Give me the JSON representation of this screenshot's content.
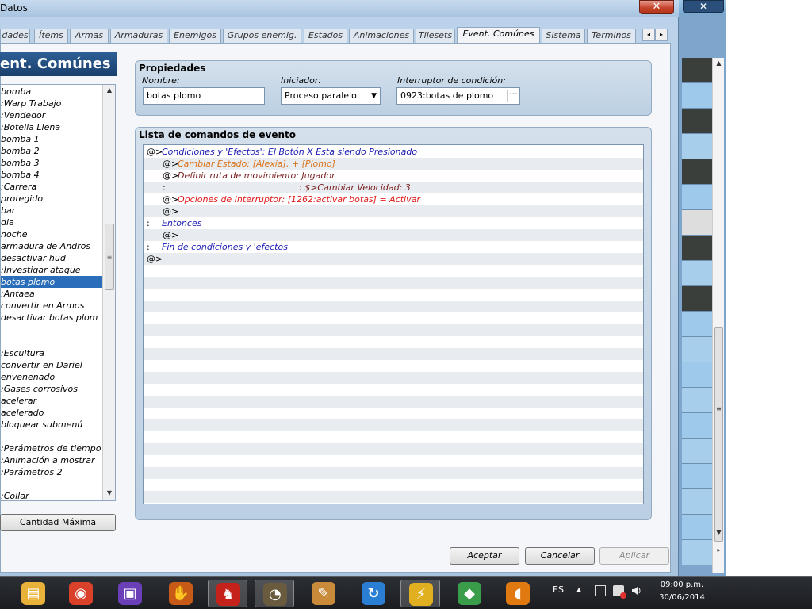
{
  "window": {
    "title": "Datos",
    "close_glyph": "✕"
  },
  "tabs": [
    {
      "label": "dades"
    },
    {
      "label": "Ítems"
    },
    {
      "label": "Armas"
    },
    {
      "label": "Armaduras"
    },
    {
      "label": "Enemigos"
    },
    {
      "label": "Grupos enemig."
    },
    {
      "label": "Estados"
    },
    {
      "label": "Animaciones"
    },
    {
      "label": "Tilesets"
    },
    {
      "label": "Event. Comúnes",
      "active": true
    },
    {
      "label": "Sistema"
    },
    {
      "label": "Terminos"
    }
  ],
  "tab_scroll": {
    "left": "◂",
    "right": "▸"
  },
  "list": {
    "header": "ent. Comúnes",
    "selected_index": 16,
    "items": [
      "bomba",
      ":Warp Trabajo",
      ":Vendedor",
      ":Botella Llena",
      "bomba 1",
      "bomba 2",
      "bomba 3",
      "bomba 4",
      ":Carrera",
      "protegido",
      "bar",
      "dia",
      "noche",
      "armadura de Andros",
      "desactivar hud",
      ":Investigar ataque",
      "botas plomo",
      ":Antaea",
      "convertir en Armos",
      "desactivar botas plom",
      "",
      "",
      ":Escultura",
      "convertir en Dariel",
      "envenenado",
      ":Gases corrosivos",
      "acelerar",
      "acelerado",
      "bloquear submenú",
      "",
      ":Parámetros de tiempo",
      ":Animación a mostrar",
      ":Parámetros 2",
      "",
      ":Collar"
    ],
    "scroll_up": "▲",
    "scroll_down": "▼",
    "thumb_grip": "≡"
  },
  "max_button": "Cantidad Máxima",
  "properties": {
    "title": "Propiedades",
    "name_label": "Nombre:",
    "name_value": "botas plomo",
    "trigger_label": "Iniciador:",
    "trigger_value": "Proceso paralelo",
    "trigger_arrow": "▼",
    "switch_label": "Interruptor de condición:",
    "switch_value": "0923:botas de plomo",
    "switch_dots": "···"
  },
  "commands": {
    "title": "Lista de comandos de evento",
    "colors": {
      "blue": "#1a1ab4",
      "orange": "#d9731a",
      "maroon": "#7a1e1e",
      "red": "#e01a1a"
    },
    "rows": [
      {
        "prefix": "@>",
        "text": "Condiciones y 'Efectos': El Botón X Esta siendo Presionado",
        "color": "blue",
        "indent": 0
      },
      {
        "prefix": "@>",
        "text": "Cambiar Estado: [Alexia], + [Plomo]",
        "color": "orange",
        "indent": 1
      },
      {
        "prefix": "@>",
        "text": "Definir ruta de movimiento: Jugador",
        "color": "maroon",
        "indent": 1
      },
      {
        "prefix": ":",
        "text": ": $>Cambiar Velocidad: 3",
        "color": "maroon",
        "indent": 1,
        "wide": true
      },
      {
        "prefix": "@>",
        "text": "Opciones de Interruptor: [1262:activar botas] = Activar",
        "color": "red",
        "indent": 1
      },
      {
        "prefix": "@>",
        "text": "",
        "color": "blue",
        "indent": 1
      },
      {
        "prefix": ":",
        "text": "Entonces",
        "color": "blue",
        "indent": 0
      },
      {
        "prefix": "@>",
        "text": "",
        "color": "blue",
        "indent": 1
      },
      {
        "prefix": ":",
        "text": "Fin de condiciones y 'efectos'",
        "color": "blue",
        "indent": 0
      },
      {
        "prefix": "@>",
        "text": "",
        "color": "blue",
        "indent": 0
      }
    ]
  },
  "footer": {
    "ok": "Aceptar",
    "cancel": "Cancelar",
    "apply": "Aplicar"
  },
  "taskbar": {
    "apps": [
      {
        "icon": "file-explorer-icon",
        "glyph": "▤",
        "color": "#e8b23a"
      },
      {
        "icon": "chrome-icon",
        "glyph": "◉",
        "color": "#d9412b"
      },
      {
        "icon": "game-boy-advance-icon",
        "glyph": "▣",
        "color": "#6a3fb8"
      },
      {
        "icon": "glove-icon",
        "glyph": "✋",
        "color": "#c65a16"
      },
      {
        "icon": "rpg-maker-dragon-icon",
        "glyph": "♞",
        "color": "#c4221a"
      },
      {
        "icon": "gimp-icon",
        "glyph": "◔",
        "color": "#6b5b3e"
      },
      {
        "icon": "paint-palette-icon",
        "glyph": "✎",
        "color": "#c98a3a"
      },
      {
        "icon": "refresh-shield-icon",
        "glyph": "↻",
        "color": "#2a7fd4"
      },
      {
        "icon": "winamp-icon",
        "glyph": "⚡",
        "color": "#e0b020"
      },
      {
        "icon": "cube-app-icon",
        "glyph": "◆",
        "color": "#3a9d4a"
      },
      {
        "icon": "vlc-headset-icon",
        "glyph": "◖",
        "color": "#e07a10"
      }
    ],
    "lang": "ES",
    "time": "09:00 p.m.",
    "date": "30/06/2014",
    "up_arrow": "▲"
  },
  "bg_app": {
    "close_glyph": "✕",
    "scroll_up": "▲",
    "scroll_down": "▼",
    "scroll_right": "▸",
    "thumb_grip": "≡"
  }
}
